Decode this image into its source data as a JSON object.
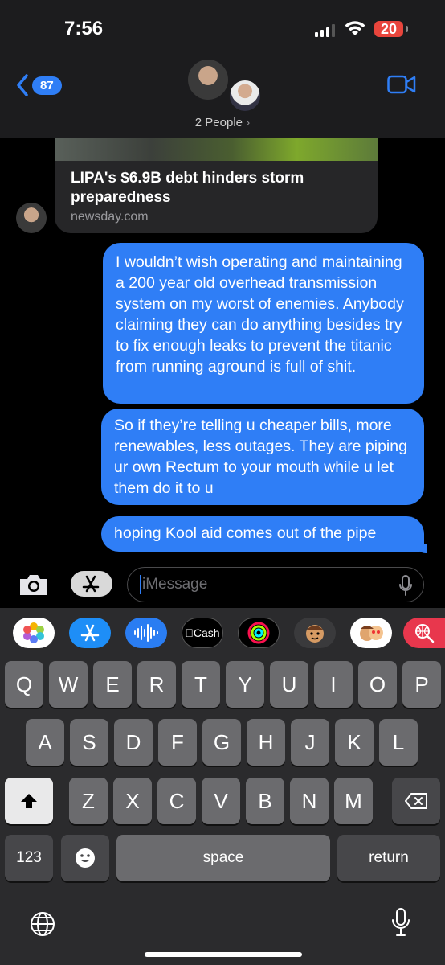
{
  "status_bar": {
    "time": "7:56",
    "battery": "20"
  },
  "header": {
    "back_count": "87",
    "title": "2 People",
    "title_chevron": "›"
  },
  "conversation": {
    "link_preview": {
      "title": "LIPA's $6.9B debt hinders storm preparedness",
      "domain": "newsday.com"
    },
    "messages": [
      {
        "from": "me",
        "text": "I wouldn’t wish operating and maintaining a 200 year old overhead transmission system on my worst of enemies.  Anybody claiming they can do anything besides try to fix enough leaks to prevent the titanic from running aground is full of shit."
      },
      {
        "from": "me",
        "text": "So if they’re telling u cheaper bills, more renewables, less outages.  They are piping ur own Rectum to your mouth while u let them do it to u"
      },
      {
        "from": "me",
        "text": "hoping Kool aid comes out of the pipe"
      }
    ]
  },
  "input": {
    "placeholder": "iMessage"
  },
  "app_strip": {
    "apps": [
      "photos-icon",
      "app-store-icon",
      "audio-message-icon",
      "apple-cash",
      "activity-icon",
      "memoji-icon",
      "memoji-stickers-icon",
      "web-search-icon"
    ],
    "cash_label": "Cash"
  },
  "keyboard": {
    "row1": [
      "Q",
      "W",
      "E",
      "R",
      "T",
      "Y",
      "U",
      "I",
      "O",
      "P"
    ],
    "row2": [
      "A",
      "S",
      "D",
      "F",
      "G",
      "H",
      "J",
      "K",
      "L"
    ],
    "row3": [
      "Z",
      "X",
      "C",
      "V",
      "B",
      "N",
      "M"
    ],
    "numbers_label": "123",
    "space_label": "space",
    "return_label": "return"
  },
  "colors": {
    "accent": "#2f7ef6",
    "battery_low": "#e8453c",
    "header_bg": "#1c1c1e",
    "keyboard_bg": "#2b2b2d",
    "key": "#6b6b6e"
  }
}
